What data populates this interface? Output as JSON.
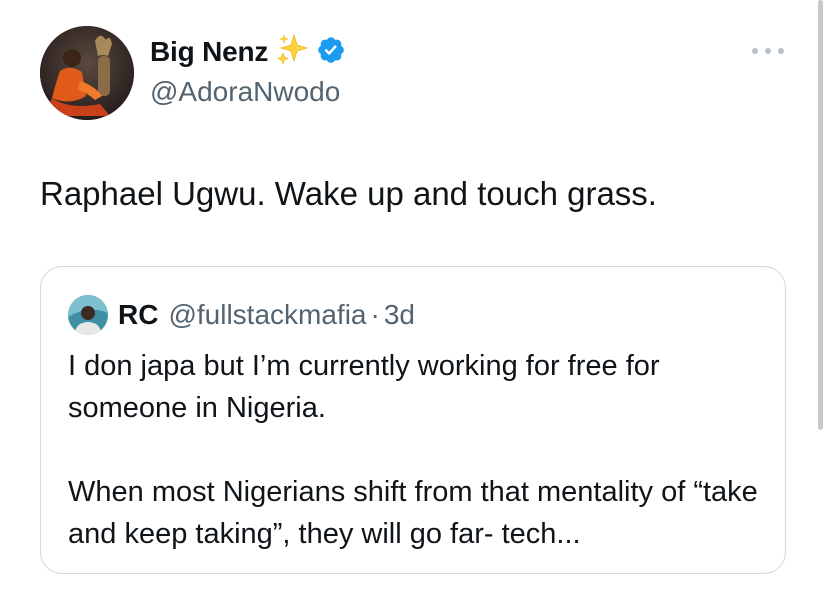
{
  "author": {
    "display_name": "Big Nenz",
    "handle": "@AdoraNwodo",
    "sparkles_icon": "sparkles-icon",
    "verified_icon": "verified-badge-icon",
    "verified_color": "#1d9bf0"
  },
  "tweet": {
    "text": "Raphael Ugwu. Wake up and touch grass."
  },
  "quoted_tweet": {
    "display_name": "RC",
    "handle": "@fullstackmafia",
    "separator": "·",
    "time": "3d",
    "paragraphs": [
      "I don japa but I’m currently working for free for someone in Nigeria.",
      "When most Nigerians shift from that mentality of “take and keep taking”, they will go far- tech..."
    ]
  },
  "colors": {
    "text_primary": "#0f1419",
    "text_secondary": "#536471",
    "border": "#cfd9de"
  }
}
